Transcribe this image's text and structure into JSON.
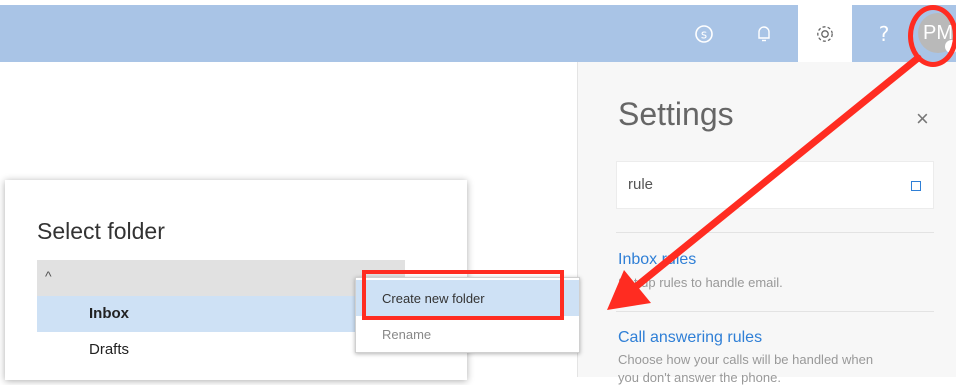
{
  "topbar": {
    "avatar_initials": "PM",
    "help_label": "?",
    "accent_color": "#a9c4e6"
  },
  "settings": {
    "title": "Settings",
    "close_label": "×",
    "search_value": "rule",
    "results": [
      {
        "title": "Inbox rules",
        "description": "Set up rules to handle email."
      },
      {
        "title": "Call answering rules",
        "description": "Choose how your calls will be handled when",
        "description_line2": "you don't answer the phone."
      }
    ]
  },
  "dialog": {
    "title": "Select folder",
    "header_caret": "^",
    "folders": [
      "Inbox",
      "Drafts"
    ]
  },
  "context_menu": {
    "items": [
      "Create new folder",
      "Rename"
    ]
  },
  "annotation_color": "#ff2c21"
}
